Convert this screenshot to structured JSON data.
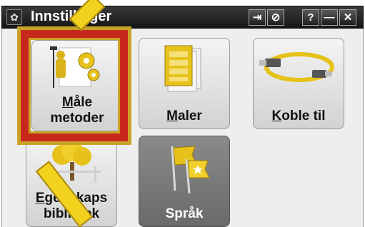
{
  "window": {
    "title": "Innstillinger",
    "buttons": {
      "login": "⇥",
      "disable": "⊘",
      "help": "?",
      "minimize": "—",
      "close": "✕"
    }
  },
  "tiles": [
    {
      "label_line1": "Måle",
      "label_line2": "metoder",
      "icon": "measure-methods-icon"
    },
    {
      "label": "Maler",
      "icon": "templates-icon"
    },
    {
      "label": "Koble til",
      "icon": "connect-cable-icon"
    },
    {
      "label_line1": "Egenskaps",
      "label_line2": "bibliotek",
      "icon": "feature-library-icon"
    },
    {
      "label": "Språk",
      "icon": "language-flags-icon"
    }
  ],
  "colors": {
    "highlight_red": "#c8281b",
    "highlight_gold": "#c9a227",
    "arrow": "#f2d11f"
  }
}
